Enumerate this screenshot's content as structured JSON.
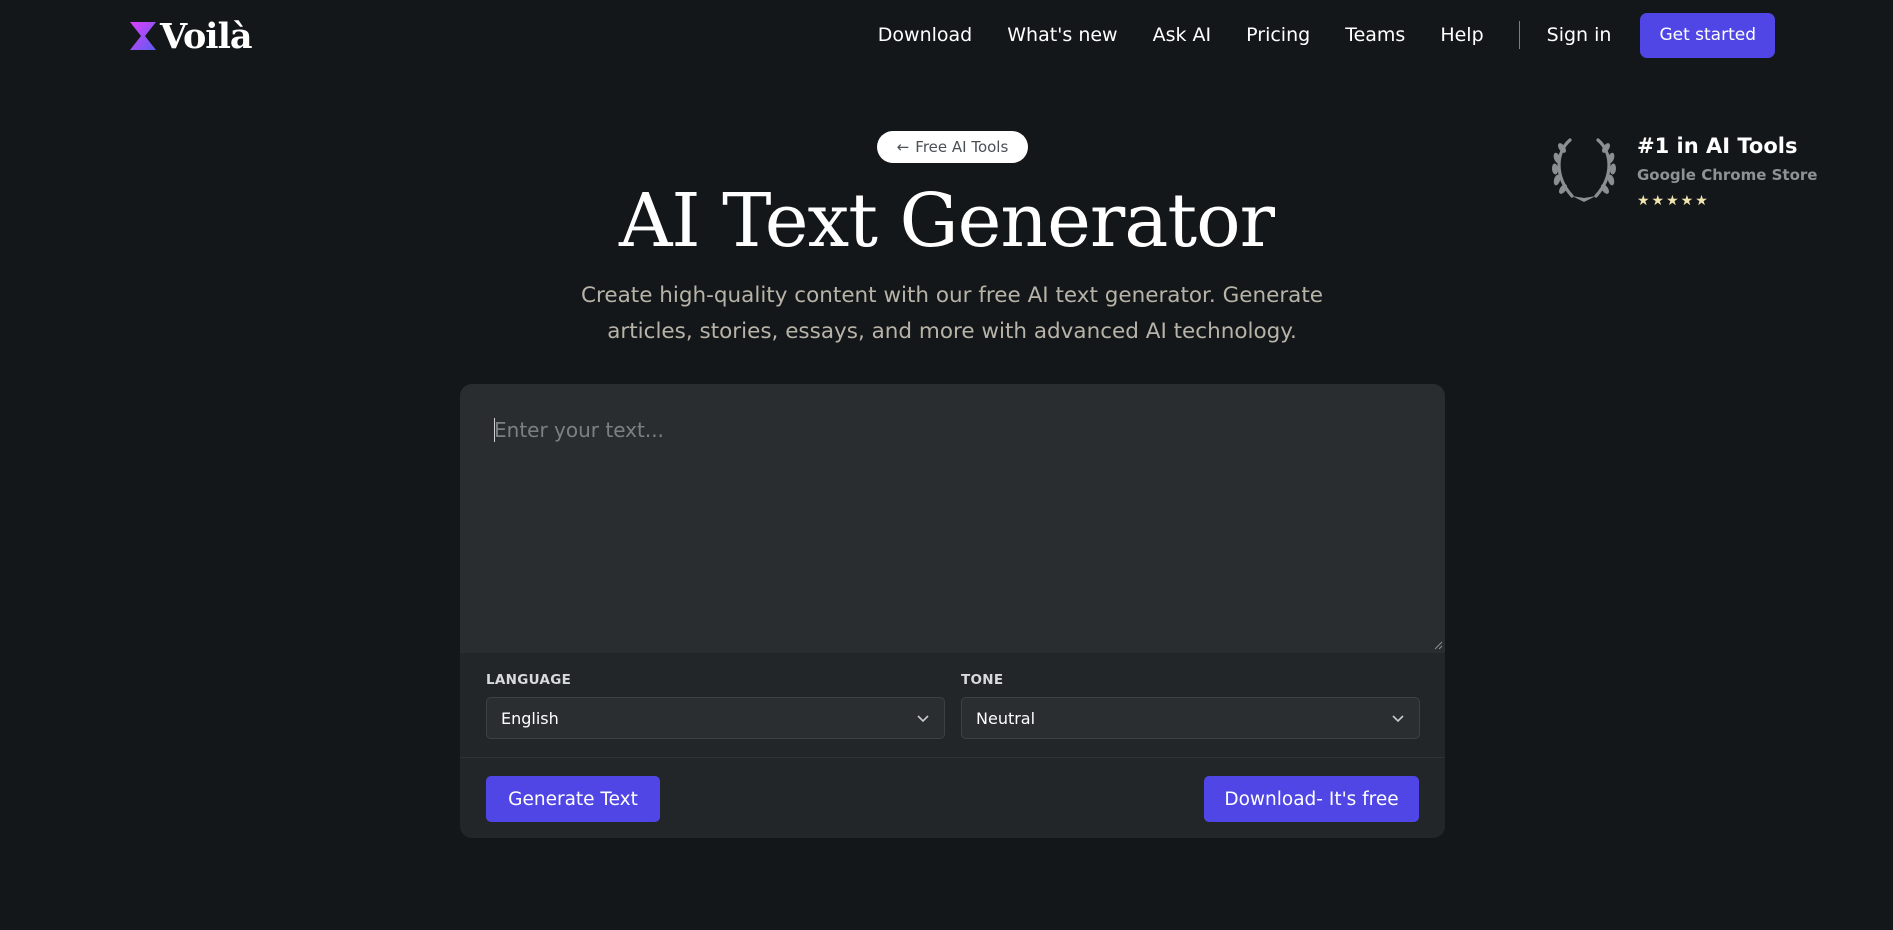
{
  "brand": {
    "name": "Voilà",
    "accent": "#4f46e5"
  },
  "nav": {
    "links": [
      "Download",
      "What's new",
      "Ask AI",
      "Pricing",
      "Teams",
      "Help"
    ],
    "sign_in": "Sign in",
    "get_started": "Get started"
  },
  "award": {
    "title": "#1 in AI Tools",
    "subtitle": "Google Chrome Store",
    "stars": "★★★★★",
    "rating_stars": 5
  },
  "hero": {
    "back_pill": "Free AI Tools",
    "back_pill_icon": "arrow-left-icon",
    "title": "AI Text Generator",
    "subtitle": "Create high-quality content with our free AI text generator. Generate articles, stories, essays, and more with advanced AI technology."
  },
  "editor": {
    "placeholder": "Enter your text...",
    "value": "",
    "language_label": "LANGUAGE",
    "language_value": "English",
    "tone_label": "TONE",
    "tone_value": "Neutral",
    "generate_button": "Generate Text",
    "download_button": "Download- It's free"
  }
}
